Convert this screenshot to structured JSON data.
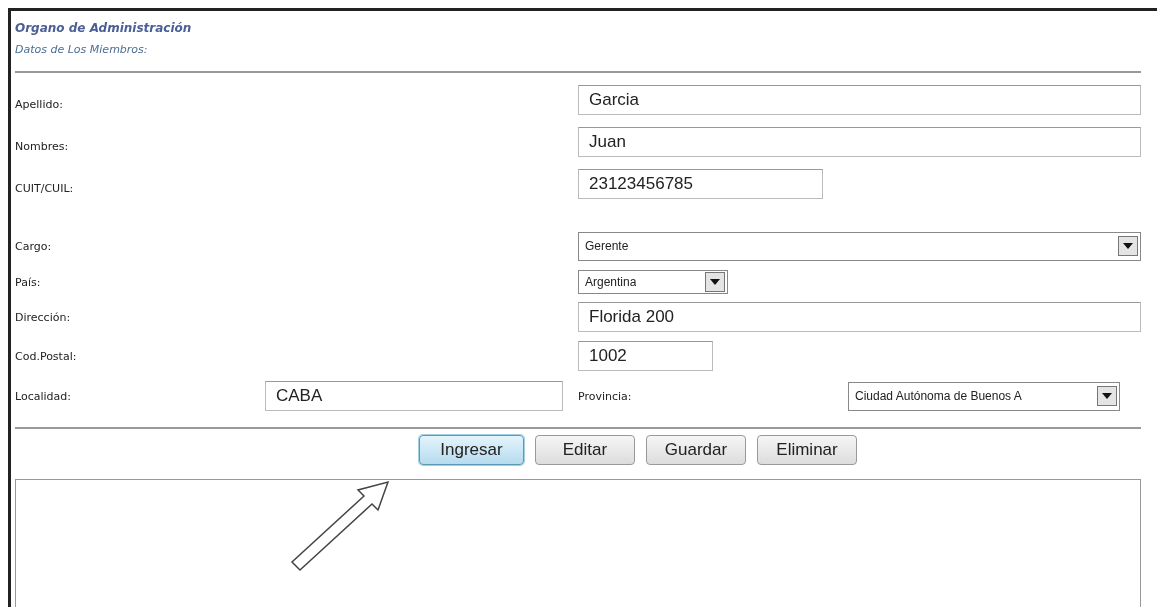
{
  "header": {
    "title": "Organo de Administración",
    "subtitle": "Datos de Los Miembros:"
  },
  "fields": [
    {
      "kind": "text",
      "label": "Apellido:",
      "value": "Garcia"
    },
    {
      "kind": "text",
      "label": "Nombres:",
      "value": "Juan"
    },
    {
      "kind": "text",
      "label": "CUIT/CUIL:",
      "value": "23123456785"
    },
    {
      "kind": "select",
      "label": "Cargo:",
      "value": "Gerente"
    },
    {
      "kind": "select",
      "label": "País:",
      "value": "Argentina"
    },
    {
      "kind": "text",
      "label": "Dirección:",
      "value": "Florida 200"
    },
    {
      "kind": "text",
      "label": "Cod.Postal:",
      "value": "1002"
    }
  ],
  "location": {
    "label": "Localidad:",
    "value": "CABA",
    "province_label": "Provincia:",
    "province_value": "Ciudad Autónoma de Buenos A"
  },
  "buttons": [
    {
      "label": "Ingresar",
      "focused": true
    },
    {
      "label": "Editar",
      "focused": false
    },
    {
      "label": "Guardar",
      "focused": false
    },
    {
      "label": "Eliminar",
      "focused": false
    }
  ]
}
